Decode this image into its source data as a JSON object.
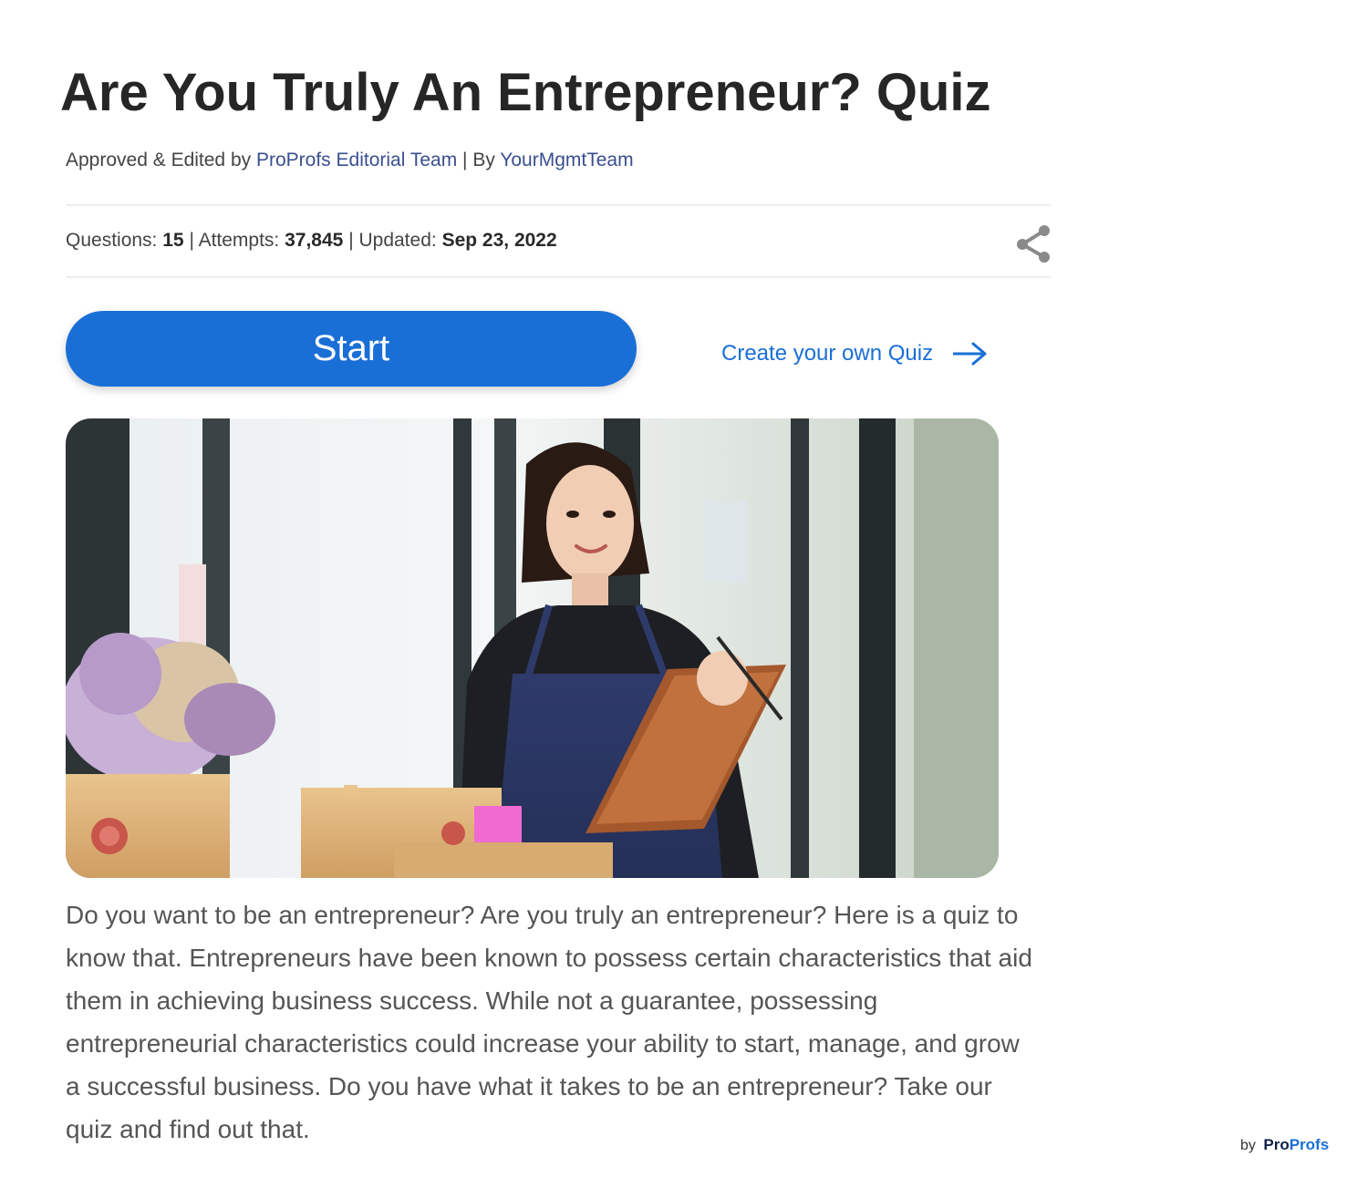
{
  "quiz": {
    "title": "Are You Truly An Entrepreneur? Quiz",
    "byline": {
      "approved_label": "Approved & Edited by",
      "editor": "ProProfs Editorial Team",
      "separator": "| By",
      "author": "YourMgmtTeam"
    },
    "stats": {
      "questions_label": "Questions:",
      "questions_value": "15",
      "attempts_label": "| Attempts:",
      "attempts_value": "37,845",
      "updated_label": "| Updated:",
      "updated_value": "Sep 23, 2022"
    },
    "share_icon": "share-icon",
    "start_label": "Start",
    "create_label": "Create your own Quiz",
    "create_icon": "arrow-right-icon",
    "description": "Do you want to be an entrepreneur? Are you truly an entrepreneur? Here is a quiz to know that. Entrepreneurs have been known to possess certain characteristics that aid them in achieving business success. While not a guarantee, possessing entrepreneurial characteristics could increase your ability to start, manage, and grow a successful business. Do you have what it takes to be an entrepreneur? Take our quiz and find out that."
  },
  "branding": {
    "by_label": "by",
    "logo_part1": "Pro",
    "logo_part2": "Profs"
  },
  "colors": {
    "accent": "#1a6fd6",
    "link": "#3a4f8f",
    "title": "#262626",
    "text": "#555555"
  }
}
